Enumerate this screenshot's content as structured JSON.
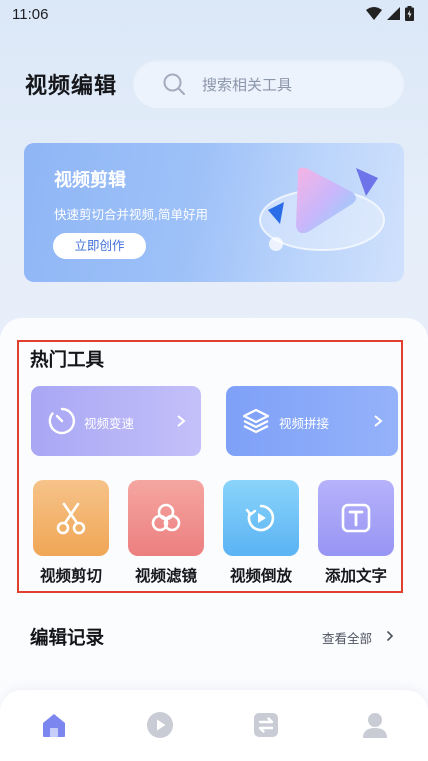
{
  "status": {
    "time": "11:06"
  },
  "header": {
    "title": "视频编辑",
    "search_placeholder": "搜索相关工具"
  },
  "banner": {
    "title": "视频剪辑",
    "subtitle": "快速剪切合并视频,简单好用",
    "button": "立即创作"
  },
  "hot_tools": {
    "title": "热门工具",
    "wide": [
      {
        "label": "视频变速",
        "icon": "speed-timer-icon"
      },
      {
        "label": "视频拼接",
        "icon": "layers-icon"
      }
    ],
    "tools": [
      {
        "label": "视频剪切",
        "icon": "scissors-icon"
      },
      {
        "label": "视频滤镜",
        "icon": "filter-circles-icon"
      },
      {
        "label": "视频倒放",
        "icon": "reverse-play-icon"
      },
      {
        "label": "添加文字",
        "icon": "text-box-icon"
      }
    ]
  },
  "records": {
    "title": "编辑记录",
    "view_all": "查看全部"
  },
  "nav": [
    {
      "icon": "home-icon",
      "active": true
    },
    {
      "icon": "play-circle-icon",
      "active": false
    },
    {
      "icon": "swap-icon",
      "active": false
    },
    {
      "icon": "user-icon",
      "active": false
    }
  ],
  "colors": {
    "accent": "#3f6fd8",
    "highlight_border": "#e2402e",
    "nav_active": "#7b86ee",
    "nav_inactive": "#c9ccd4"
  }
}
